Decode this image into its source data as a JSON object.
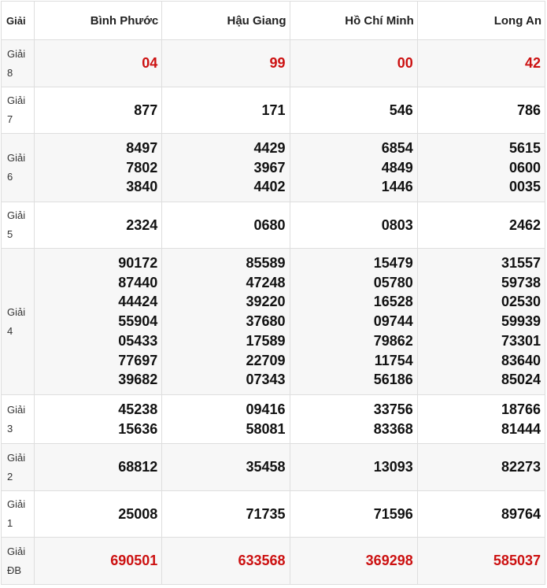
{
  "header": {
    "label": "Giải",
    "provinces": [
      "Bình Phước",
      "Hậu Giang",
      "Hồ Chí Minh",
      "Long An"
    ]
  },
  "prizes": [
    {
      "label": [
        "Giải",
        "8"
      ],
      "highlight": true,
      "values": [
        [
          "04"
        ],
        [
          "99"
        ],
        [
          "00"
        ],
        [
          "42"
        ]
      ]
    },
    {
      "label": [
        "Giải",
        "7"
      ],
      "highlight": false,
      "values": [
        [
          "877"
        ],
        [
          "171"
        ],
        [
          "546"
        ],
        [
          "786"
        ]
      ]
    },
    {
      "label": [
        "Giải",
        "6"
      ],
      "highlight": false,
      "values": [
        [
          "8497",
          "7802",
          "3840"
        ],
        [
          "4429",
          "3967",
          "4402"
        ],
        [
          "6854",
          "4849",
          "1446"
        ],
        [
          "5615",
          "0600",
          "0035"
        ]
      ]
    },
    {
      "label": [
        "Giải",
        "5"
      ],
      "highlight": false,
      "values": [
        [
          "2324"
        ],
        [
          "0680"
        ],
        [
          "0803"
        ],
        [
          "2462"
        ]
      ]
    },
    {
      "label": [
        "Giải",
        "4"
      ],
      "highlight": false,
      "values": [
        [
          "90172",
          "87440",
          "44424",
          "55904",
          "05433",
          "77697",
          "39682"
        ],
        [
          "85589",
          "47248",
          "39220",
          "37680",
          "17589",
          "22709",
          "07343"
        ],
        [
          "15479",
          "05780",
          "16528",
          "09744",
          "79862",
          "11754",
          "56186"
        ],
        [
          "31557",
          "59738",
          "02530",
          "59939",
          "73301",
          "83640",
          "85024"
        ]
      ]
    },
    {
      "label": [
        "Giải",
        "3"
      ],
      "highlight": false,
      "values": [
        [
          "45238",
          "15636"
        ],
        [
          "09416",
          "58081"
        ],
        [
          "33756",
          "83368"
        ],
        [
          "18766",
          "81444"
        ]
      ]
    },
    {
      "label": [
        "Giải",
        "2"
      ],
      "highlight": false,
      "values": [
        [
          "68812"
        ],
        [
          "35458"
        ],
        [
          "13093"
        ],
        [
          "82273"
        ]
      ]
    },
    {
      "label": [
        "Giải",
        "1"
      ],
      "highlight": false,
      "values": [
        [
          "25008"
        ],
        [
          "71735"
        ],
        [
          "71596"
        ],
        [
          "89764"
        ]
      ]
    },
    {
      "label": [
        "Giải",
        "ĐB"
      ],
      "highlight": true,
      "values": [
        [
          "690501"
        ],
        [
          "633568"
        ],
        [
          "369298"
        ],
        [
          "585037"
        ]
      ]
    }
  ],
  "colors": {
    "highlight": "#cc1111",
    "text": "#111111",
    "row_alt": "#f7f7f7",
    "border": "#dedede"
  }
}
